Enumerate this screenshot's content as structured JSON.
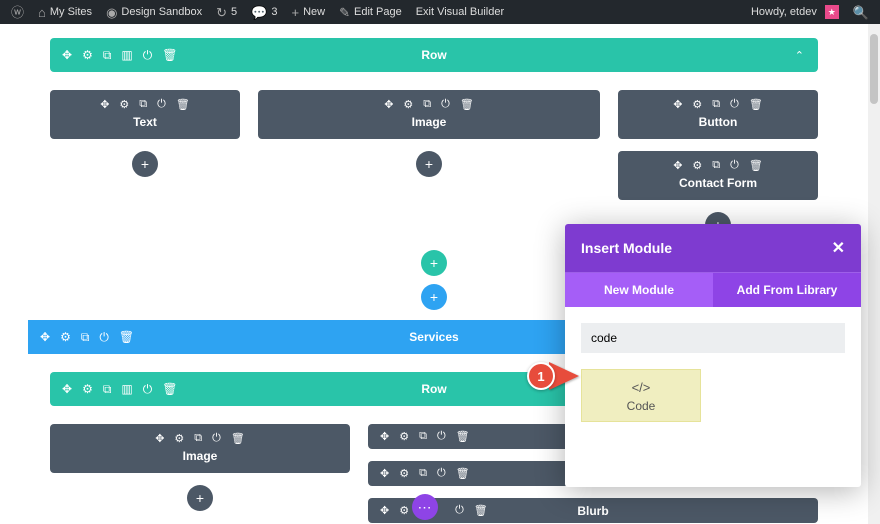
{
  "adminbar": {
    "my_sites": "My Sites",
    "site_name": "Design Sandbox",
    "updates": "5",
    "comments": "3",
    "new": "New",
    "edit_page": "Edit Page",
    "exit_vb": "Exit Visual Builder",
    "howdy": "Howdy, etdev"
  },
  "row1": {
    "label": "Row"
  },
  "modules": {
    "text": "Text",
    "image": "Image",
    "button": "Button",
    "contact_form": "Contact Form",
    "blurb": "Blurb"
  },
  "section2": {
    "label": "Services"
  },
  "row2": {
    "label": "Row"
  },
  "popup": {
    "title": "Insert Module",
    "tab_new": "New Module",
    "tab_library": "Add From Library",
    "search_value": "code",
    "result_label": "Code"
  },
  "annotation": {
    "num": "1"
  }
}
